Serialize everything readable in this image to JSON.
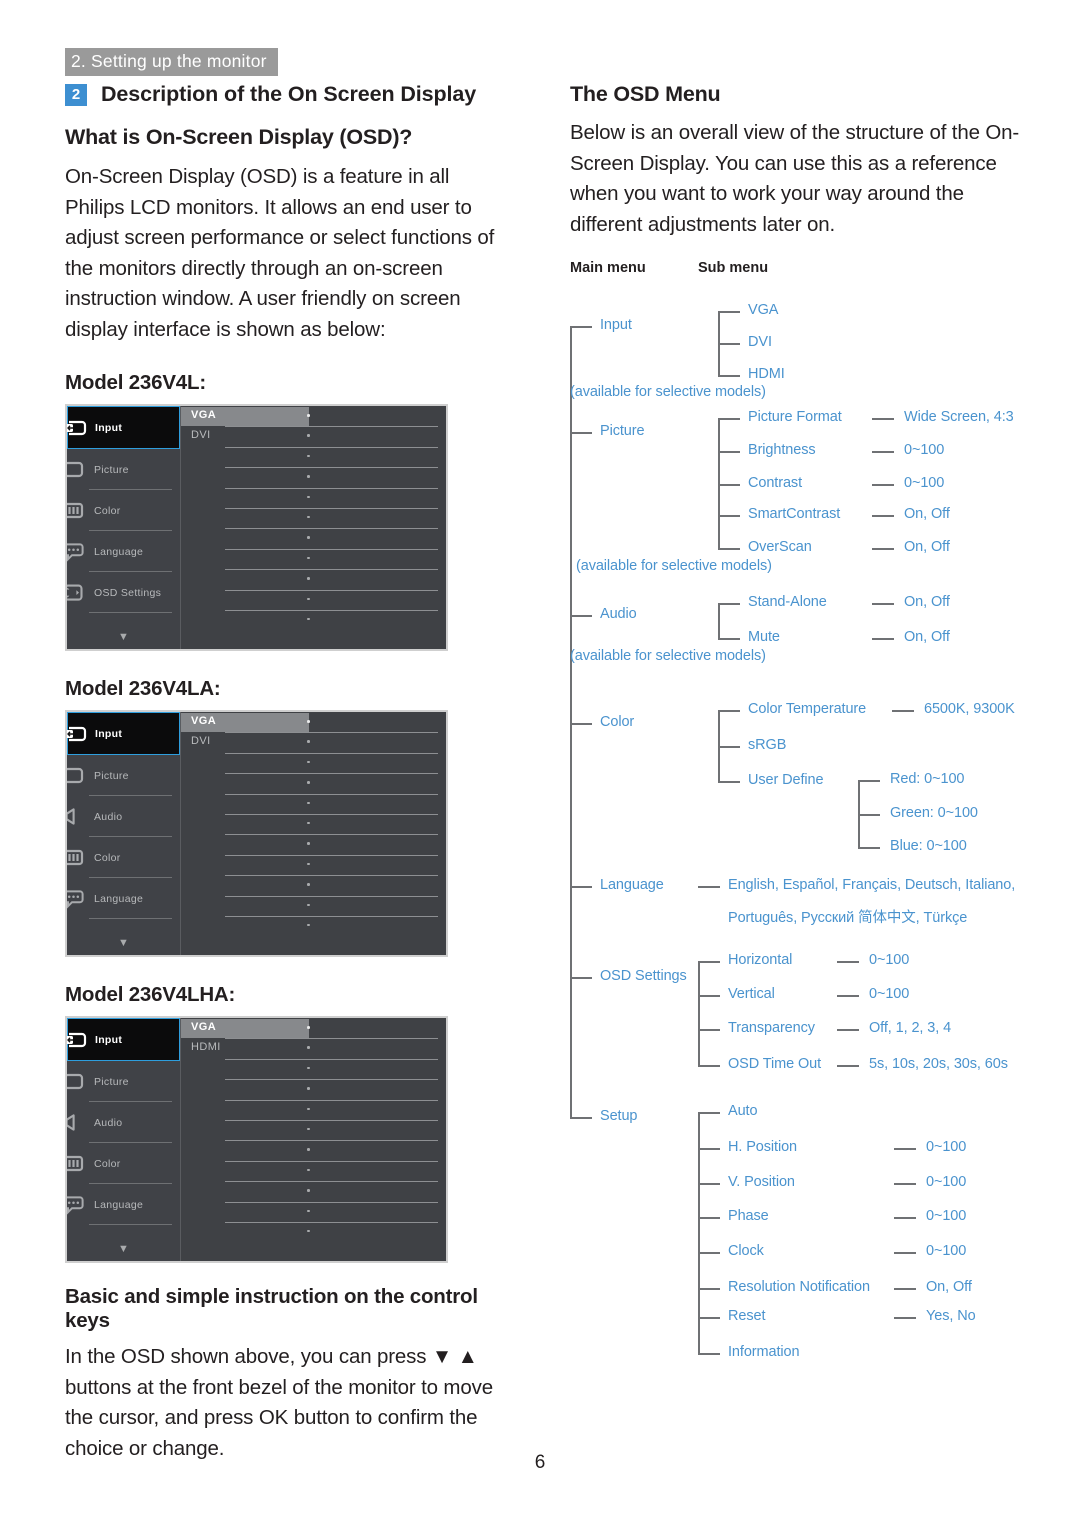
{
  "running_header": "2. Setting up the monitor",
  "section": {
    "badge": "2",
    "title": "Description of the On Screen Display"
  },
  "left": {
    "heading_what_is_osd": "What is On-Screen Display (OSD)?",
    "paragraph_osd": "On-Screen Display (OSD) is a feature in all Philips LCD monitors. It allows an end user to adjust screen performance or select functions of the monitors directly through an on-screen instruction window. A user friendly on screen display interface is shown as below:",
    "model_1_label": "Model 236V4L:",
    "model_2_label": "Model 236V4LA:",
    "model_3_label": "Model 236V4LHA:",
    "heading_control_keys": "Basic and simple instruction on the control keys",
    "paragraph_control_keys": "In the OSD shown above, you can press ▼ ▲ buttons at the front bezel of the monitor to move the cursor, and press OK button to confirm the choice or change."
  },
  "osd_screens": [
    {
      "name": "model-236v4l",
      "sidebar": [
        {
          "label": "Input",
          "icon": "input-icon",
          "selected": true
        },
        {
          "label": "Picture",
          "icon": "picture-icon",
          "selected": false
        },
        {
          "label": "Color",
          "icon": "color-icon",
          "selected": false
        },
        {
          "label": "Language",
          "icon": "language-icon",
          "selected": false
        },
        {
          "label": "OSD Settings",
          "icon": "osd-settings-icon",
          "selected": false
        }
      ],
      "scroll_caret": "▼",
      "options": [
        "VGA",
        "DVI"
      ],
      "selected_option": "VGA"
    },
    {
      "name": "model-236v4la",
      "sidebar": [
        {
          "label": "Input",
          "icon": "input-icon",
          "selected": true
        },
        {
          "label": "Picture",
          "icon": "picture-icon",
          "selected": false
        },
        {
          "label": "Audio",
          "icon": "audio-icon",
          "selected": false
        },
        {
          "label": "Color",
          "icon": "color-icon",
          "selected": false
        },
        {
          "label": "Language",
          "icon": "language-icon",
          "selected": false
        }
      ],
      "scroll_caret": "▼",
      "options": [
        "VGA",
        "DVI"
      ],
      "selected_option": "VGA"
    },
    {
      "name": "model-236v4lha",
      "sidebar": [
        {
          "label": "Input",
          "icon": "input-icon",
          "selected": true
        },
        {
          "label": "Picture",
          "icon": "picture-icon",
          "selected": false
        },
        {
          "label": "Audio",
          "icon": "audio-icon",
          "selected": false
        },
        {
          "label": "Color",
          "icon": "color-icon",
          "selected": false
        },
        {
          "label": "Language",
          "icon": "language-icon",
          "selected": false
        }
      ],
      "scroll_caret": "▼",
      "options": [
        "VGA",
        "HDMI"
      ],
      "selected_option": "VGA"
    }
  ],
  "right": {
    "heading_osd_menu": "The OSD Menu",
    "paragraph_osd_menu": "Below is an overall view of the structure of the On-Screen Display. You can use this as a reference when you want to work your way around the different adjustments later on.",
    "col_main": "Main menu",
    "col_sub": "Sub menu"
  },
  "tree": {
    "main": [
      {
        "id": "input",
        "label": "Input"
      },
      {
        "id": "picture",
        "label": "Picture"
      },
      {
        "id": "audio",
        "label": "Audio"
      },
      {
        "id": "color",
        "label": "Color"
      },
      {
        "id": "language",
        "label": "Language"
      },
      {
        "id": "osd-settings",
        "label": "OSD Settings"
      },
      {
        "id": "setup",
        "label": "Setup"
      }
    ],
    "notes": {
      "input": "(available for selective models)",
      "picture": "(available for selective models)",
      "audio": "(available for selective models)"
    },
    "sub": {
      "input": [
        "VGA",
        "DVI",
        "HDMI"
      ],
      "picture": [
        "Picture Format",
        "Brightness",
        "Contrast",
        "SmartContrast",
        "OverScan"
      ],
      "audio": [
        "Stand-Alone",
        "Mute"
      ],
      "color": [
        "Color Temperature",
        "sRGB",
        "User Define"
      ],
      "osd": [
        "Horizontal",
        "Vertical",
        "Transparency",
        "OSD Time Out"
      ],
      "setup": [
        "Auto",
        "H. Position",
        "V. Position",
        "Phase",
        "Clock",
        "Resolution Notification",
        "Reset",
        "Information"
      ]
    },
    "values": {
      "picture": [
        "Wide Screen, 4:3",
        "0~100",
        "0~100",
        "On, Off",
        "On, Off"
      ],
      "audio": [
        "On, Off",
        "On, Off"
      ],
      "color_temp": "6500K, 9300K",
      "user_define": [
        "Red: 0~100",
        "Green: 0~100",
        "Blue: 0~100"
      ],
      "language_line1": "English, Español, Français, Deutsch, Italiano,",
      "language_line2": "Português, Русский  简体中文, Türkçe",
      "osd": [
        "0~100",
        "0~100",
        "Off, 1, 2, 3, 4",
        "5s, 10s, 20s, 30s, 60s"
      ],
      "setup": [
        "",
        "0~100",
        "0~100",
        "0~100",
        "0~100",
        "On, Off",
        "Yes, No",
        ""
      ]
    }
  },
  "folio": "6",
  "colors": {
    "tree_blue": "#4a93ce",
    "badge_blue": "#3d8fd1",
    "header_gray": "#9a9a9a",
    "osd_highlight_border": "#2e9ede"
  }
}
